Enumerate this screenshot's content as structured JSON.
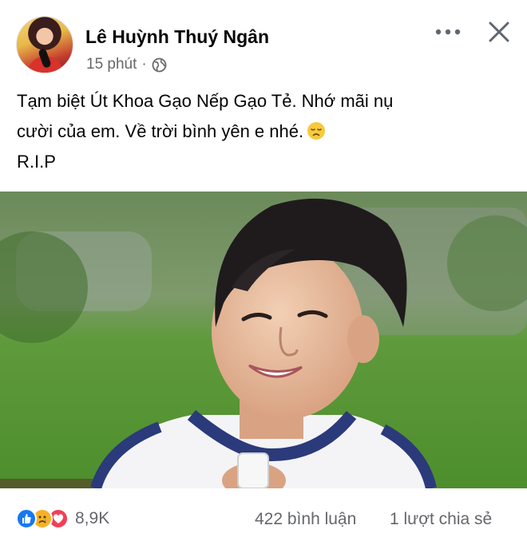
{
  "post": {
    "author_name": "Lê Huỳnh Thuý Ngân",
    "time": "15 phút",
    "separator": "·",
    "audience_icon": "globe-icon",
    "caption_lines": [
      "Tạm biệt Út Khoa Gạo Nếp Gạo Tẻ. Nhớ mãi nụ",
      "cười của em. Về trời bình yên e nhé.",
      "R.I.P"
    ],
    "caption_emoji": "sad-face-emoji",
    "photo_description_icon": "boy-photo"
  },
  "header_actions": {
    "more_icon": "more-horizontal-icon",
    "close_icon": "close-icon"
  },
  "footer": {
    "reaction_icons": [
      "like-icon",
      "sad-icon",
      "love-icon"
    ],
    "reaction_count": "8,9K",
    "comments": "422 bình luận",
    "shares": "1 lượt chia sẻ"
  },
  "colors": {
    "like": "#1877f2",
    "sad": "#f7b125",
    "love": "#f33e58",
    "meta_text": "#65676b"
  }
}
